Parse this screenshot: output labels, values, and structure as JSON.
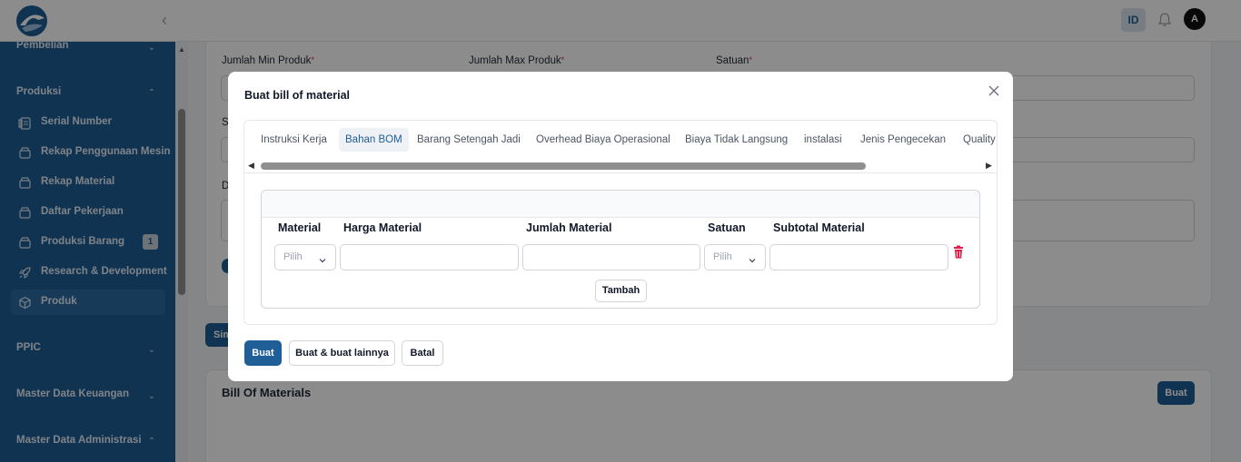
{
  "header": {
    "lang": "ID",
    "avatar_initial": "A"
  },
  "sidebar": {
    "groups": [
      {
        "label": "Pembelian"
      },
      {
        "label": "Produksi"
      },
      {
        "label": "PPIC"
      },
      {
        "label": "Master Data Keuangan"
      },
      {
        "label": "Master Data Administrasi"
      }
    ],
    "items": [
      {
        "label": "Serial Number",
        "icon": "serial-number-icon"
      },
      {
        "label": "Rekap Penggunaan Mesin",
        "icon": "box-icon"
      },
      {
        "label": "Rekap Material",
        "icon": "box-icon"
      },
      {
        "label": "Daftar Pekerjaan",
        "icon": "box-icon"
      },
      {
        "label": "Produksi Barang",
        "icon": "box-icon",
        "badge": "1"
      },
      {
        "label": "Research & Development",
        "icon": "rocket-icon"
      },
      {
        "label": "Produk",
        "icon": "cube-icon",
        "active": true
      }
    ]
  },
  "form": {
    "labels": {
      "min": "Jumlah Min Produk",
      "max": "Jumlah Max Produk",
      "satuan": "Satuan",
      "s_partial": "S",
      "d_partial": "D"
    },
    "simpan_partial": "Sim"
  },
  "bom_section": {
    "title": "Bill Of Materials",
    "create_label": "Buat"
  },
  "modal": {
    "title": "Buat bill of material",
    "tabs": [
      {
        "label": "Instruksi Kerja"
      },
      {
        "label": "Bahan BOM",
        "active": true
      },
      {
        "label": "Barang Setengah Jadi"
      },
      {
        "label": "Overhead Biaya Operasional"
      },
      {
        "label": "Biaya Tidak Langsung"
      },
      {
        "label": "instalasi"
      },
      {
        "label": "Jenis Pengecekan"
      },
      {
        "label": "Quality"
      }
    ],
    "table": {
      "headers": [
        "Material",
        "Harga Material",
        "Jumlah Material",
        "Satuan",
        "Subtotal Material"
      ],
      "row": {
        "material_placeholder": "Pilih",
        "satuan_placeholder": "Pilih"
      },
      "add_label": "Tambah"
    },
    "actions": {
      "create": "Buat",
      "create_another": "Buat & buat lainnya",
      "cancel": "Batal"
    }
  },
  "colors": {
    "primary": "#1f5e96",
    "danger": "#e11d48"
  }
}
